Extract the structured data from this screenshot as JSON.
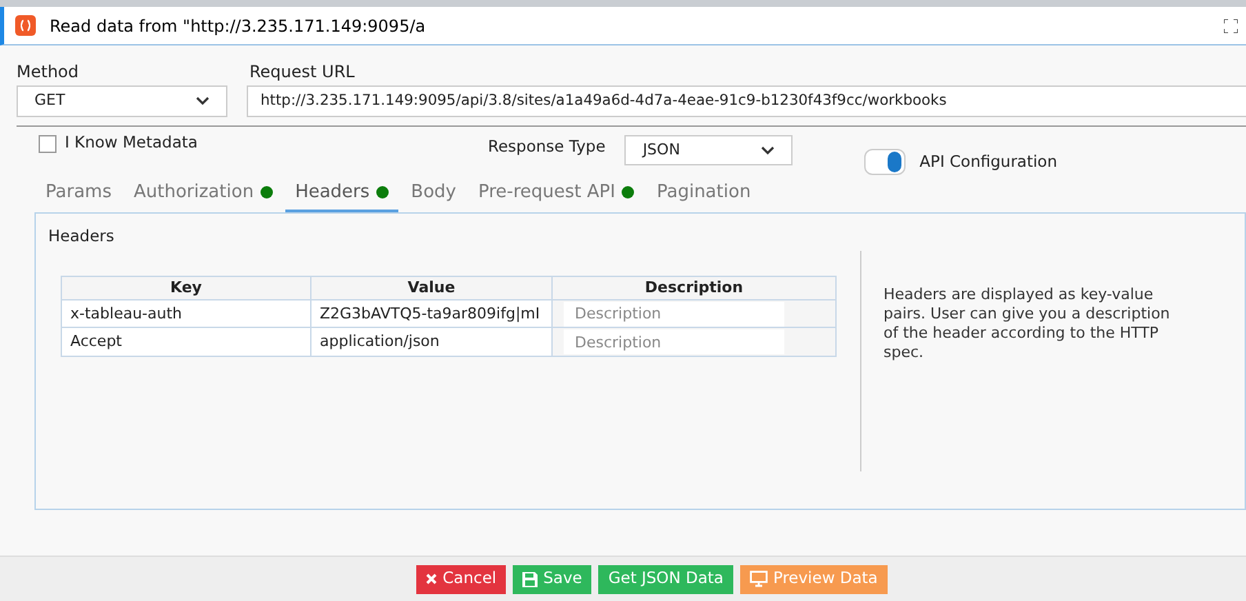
{
  "window": {
    "title": "Read data from \"http://3.235.171.149:9095/a"
  },
  "method": {
    "label": "Method",
    "value": "GET"
  },
  "request_url": {
    "label": "Request URL",
    "value": "http://3.235.171.149:9095/api/3.8/sites/a1a49a6d-4d7a-4eae-91c9-b1230f43f9cc/workbooks"
  },
  "know_metadata": {
    "label": "I Know Metadata",
    "checked": false
  },
  "response_type": {
    "label": "Response Type",
    "value": "JSON"
  },
  "tabs": [
    {
      "label": "Params",
      "selected": false,
      "dot": false
    },
    {
      "label": "Authorization",
      "selected": false,
      "dot": true
    },
    {
      "label": "Headers",
      "selected": true,
      "dot": true
    },
    {
      "label": "Body",
      "selected": false,
      "dot": false
    },
    {
      "label": "Pre-request API",
      "selected": false,
      "dot": true
    },
    {
      "label": "Pagination",
      "selected": false,
      "dot": false
    }
  ],
  "api_configuration": {
    "label": "API Configuration",
    "on": true
  },
  "headers": {
    "title": "Headers",
    "columns": [
      "Key",
      "Value",
      "Description"
    ],
    "rows": [
      {
        "key": "x-tableau-auth",
        "value": "Z2G3bAVTQ5-ta9ar809ifg|mI",
        "description_placeholder": "Description"
      },
      {
        "key": "Accept",
        "value": "application/json",
        "description_placeholder": "Description"
      }
    ],
    "help": "Headers are displayed as key-value pairs. User can give you a description of the header according to the HTTP spec."
  },
  "buttons": [
    {
      "kind": "cancel",
      "label": "Cancel"
    },
    {
      "kind": "save",
      "label": "Save"
    },
    {
      "kind": "json",
      "label": "Get JSON Data"
    },
    {
      "kind": "preview",
      "label": "Preview Data"
    }
  ]
}
